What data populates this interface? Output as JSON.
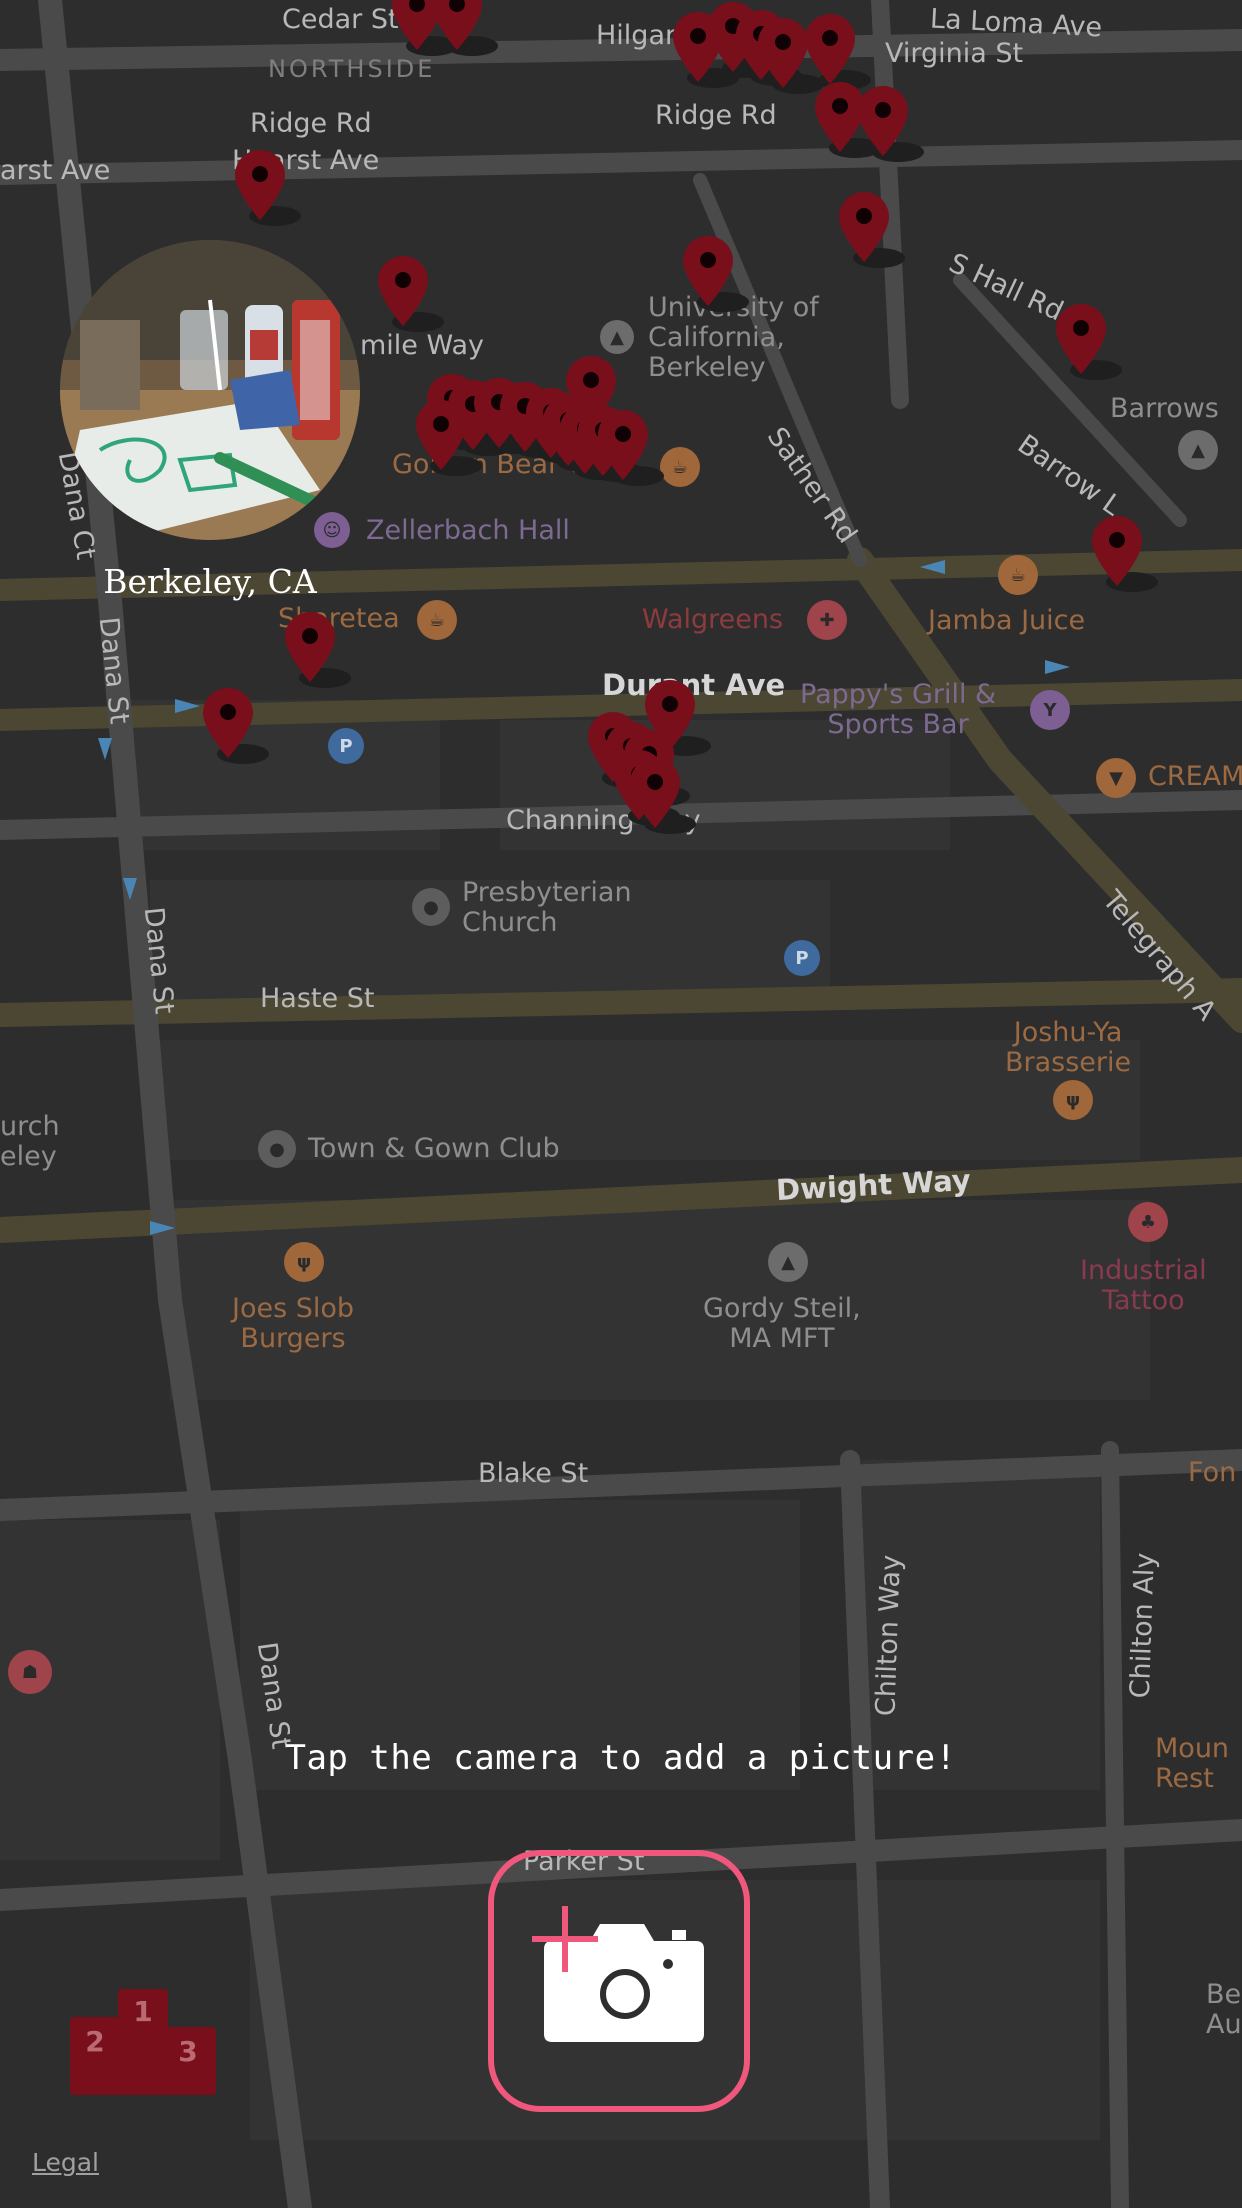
{
  "app": {
    "location_label": "Berkeley, CA",
    "hint": "Tap the camera to add a picture!",
    "legal_label": "Legal",
    "accent_color": "#f0577c",
    "pin_color": "#7a0f1c"
  },
  "leaderboard": {
    "places": [
      "1",
      "2",
      "3"
    ],
    "color": "#7a0f1c"
  },
  "map": {
    "districts": [
      "NORTHSIDE"
    ],
    "streets": {
      "cedar": "Cedar St",
      "hilgard": "Hilgar",
      "la_loma": "La Loma Ave",
      "virginia": "Virginia St",
      "ridge_left": "Ridge Rd",
      "ridge_right": "Ridge Rd",
      "hearst_left": "arst Ave",
      "hearst": "Hearst Ave",
      "s_hall": "S Hall Rd",
      "bancroft": "mile Way",
      "sather": "Sather Rd",
      "barrow": "Barrow L",
      "dana_ct": "Dana Ct",
      "dana_1": "Dana St",
      "dana_2": "Dana St",
      "dana_3": "Dana St",
      "durant": "Durant Ave",
      "channing": "Channing Way",
      "haste": "Haste St",
      "dwight": "Dwight Way",
      "telegraph": "Telegraph A",
      "blake": "Blake St",
      "chilton_way": "Chilton Way",
      "chilton_aly": "Chilton Aly",
      "parker": "Parker St"
    },
    "pois": {
      "uc_berkeley": "University of\nCalifornia,\nBerkeley",
      "barrows": "Barrows",
      "golden_bear": "Golden Bear Cafe",
      "zellerbach": "Zellerbach Hall",
      "sharetea": "Sharetea",
      "walgreens": "Walgreens",
      "jamba": "Jamba Juice",
      "pappys": "Pappy's Grill &\nSports Bar",
      "cream": "CREAM",
      "presbyterian": "Presbyterian\nChurch",
      "joshu": "Joshu-Ya\nBrasserie",
      "town_gown": "Town & Gown Club",
      "church_left": "urch\neley",
      "joes": "Joes Slob\nBurgers",
      "gordy": "Gordy Steil,\nMA MFT",
      "industrial": "Industrial\nTattoo",
      "fon": "Fon",
      "mount": "Moun\nRest",
      "be": "Be\nAu"
    }
  }
}
